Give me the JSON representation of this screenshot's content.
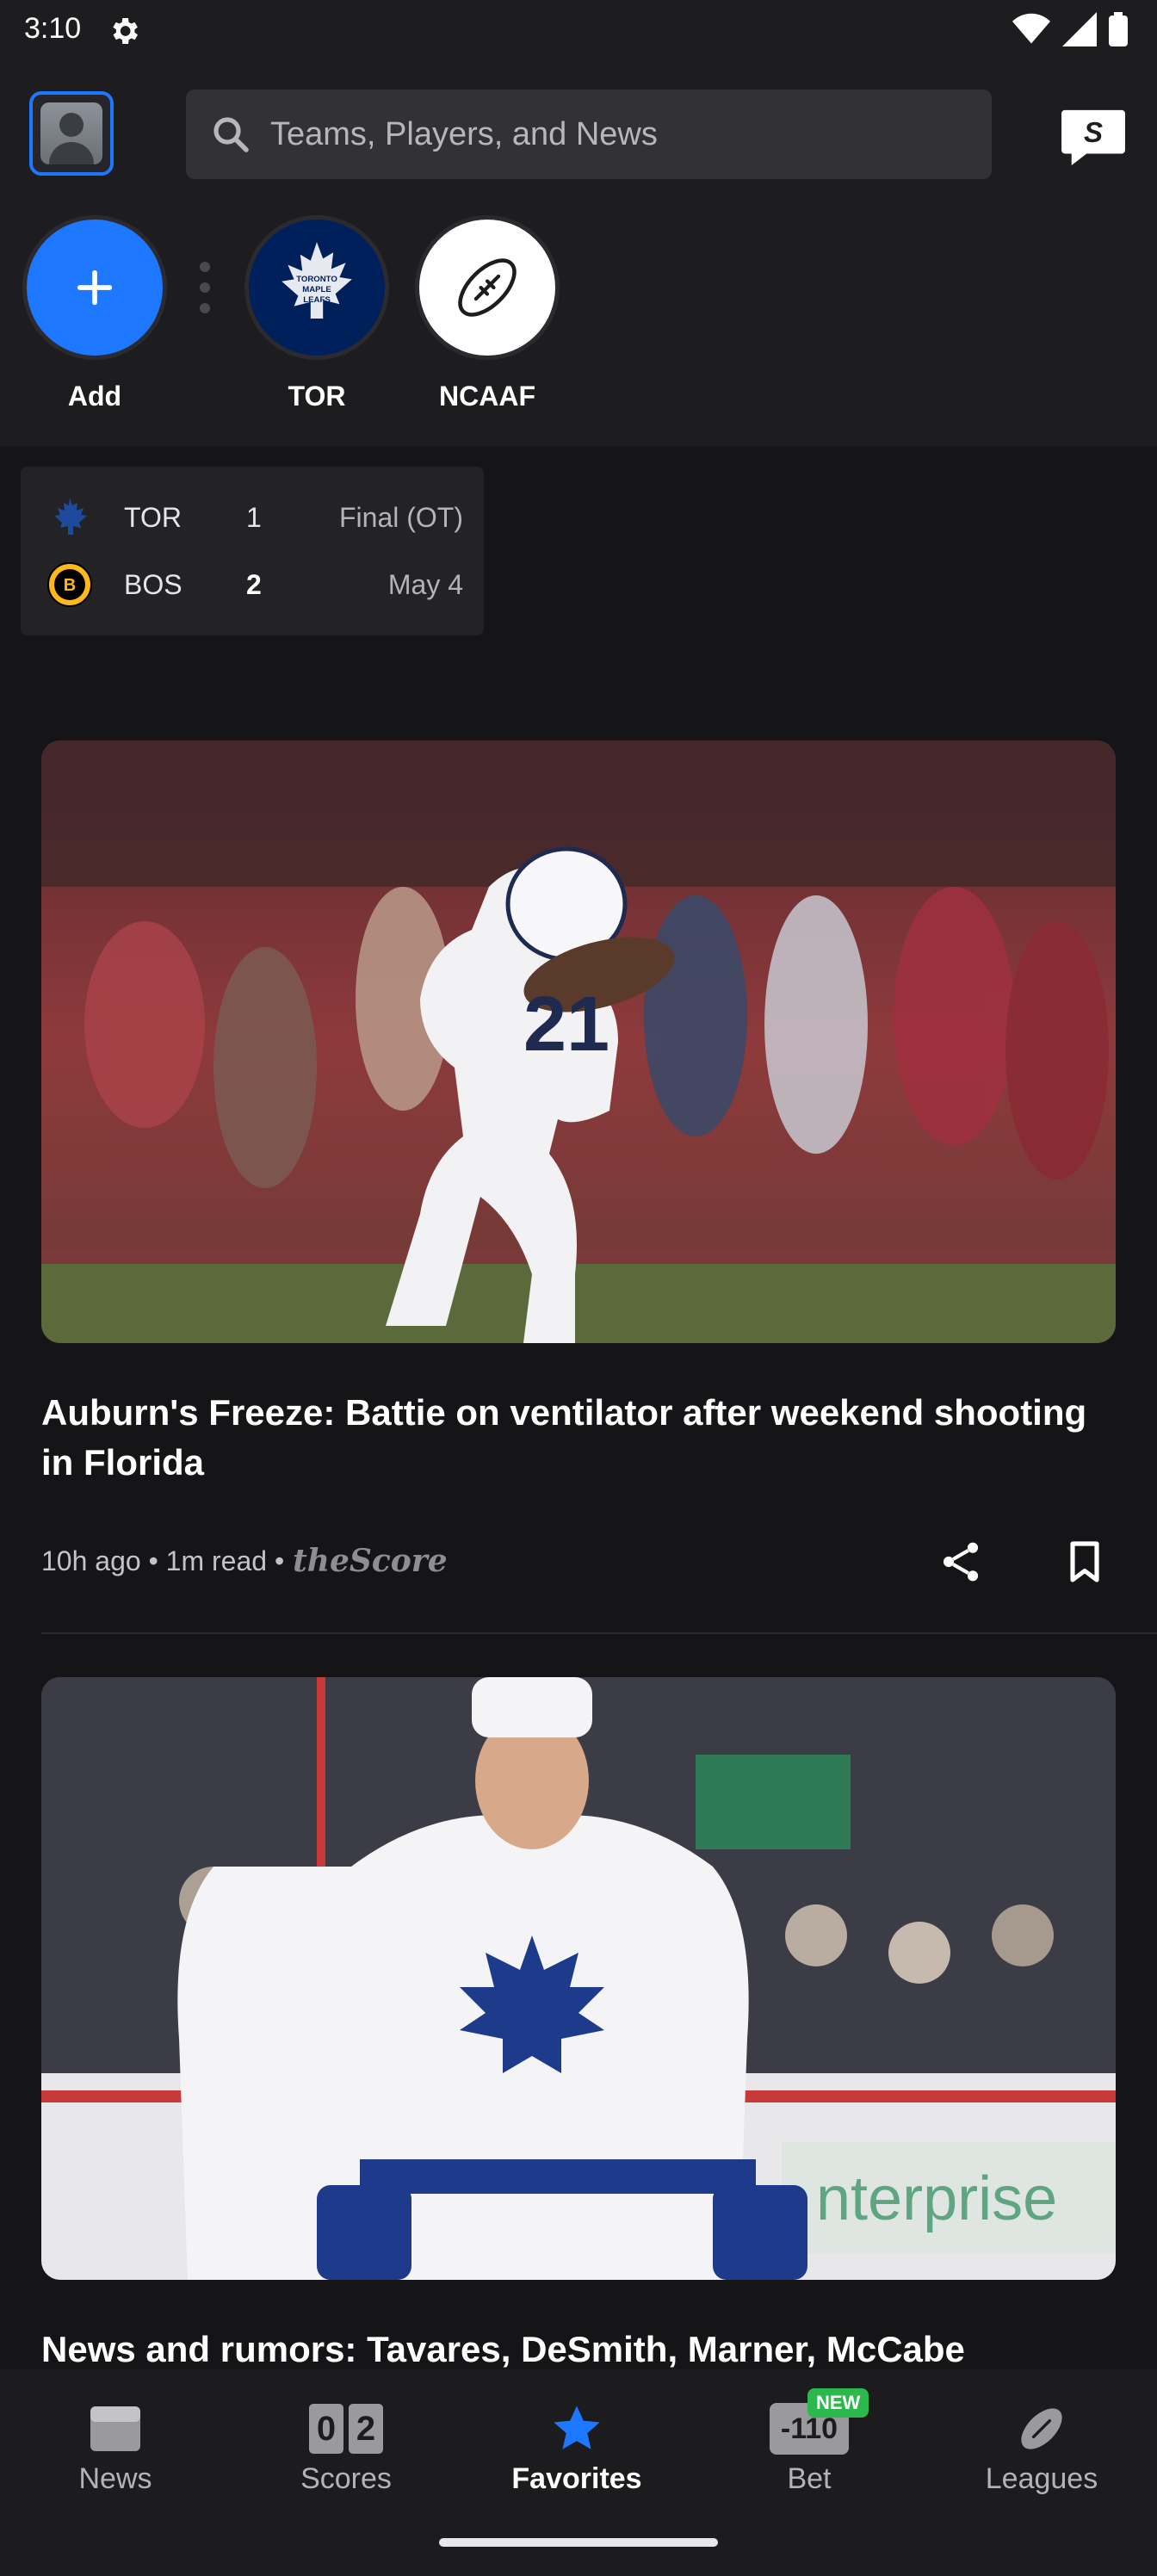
{
  "status_bar": {
    "time": "3:10"
  },
  "header": {
    "search_placeholder": "Teams, Players, and News",
    "favorites": [
      {
        "label": "Add"
      },
      {
        "label": "TOR"
      },
      {
        "label": "NCAAF"
      }
    ]
  },
  "score_card": {
    "teams": [
      {
        "abbr": "TOR",
        "score": "1",
        "status": "Final (OT)"
      },
      {
        "abbr": "BOS",
        "score": "2",
        "status": "May 4"
      }
    ]
  },
  "articles": [
    {
      "title": "Auburn's Freeze: Battie on ventilator after weekend shooting in Florida",
      "meta": "10h ago • 1m read •",
      "brand": "theScore"
    },
    {
      "title": "News and rumors: Tavares, DeSmith, Marner, McCabe"
    }
  ],
  "bottom_nav": {
    "items": [
      {
        "label": "News"
      },
      {
        "label": "Scores"
      },
      {
        "label": "Favorites"
      },
      {
        "label": "Bet",
        "badge": "NEW"
      },
      {
        "label": "Leagues"
      }
    ],
    "scores_digits": [
      "0",
      "2"
    ],
    "bet_odds": "-110"
  },
  "colors": {
    "accent": "#1e78ff",
    "background": "#151517",
    "header_bg": "#1d1d20",
    "badge_green": "#2db84d",
    "leafs_blue": "#00205b"
  }
}
